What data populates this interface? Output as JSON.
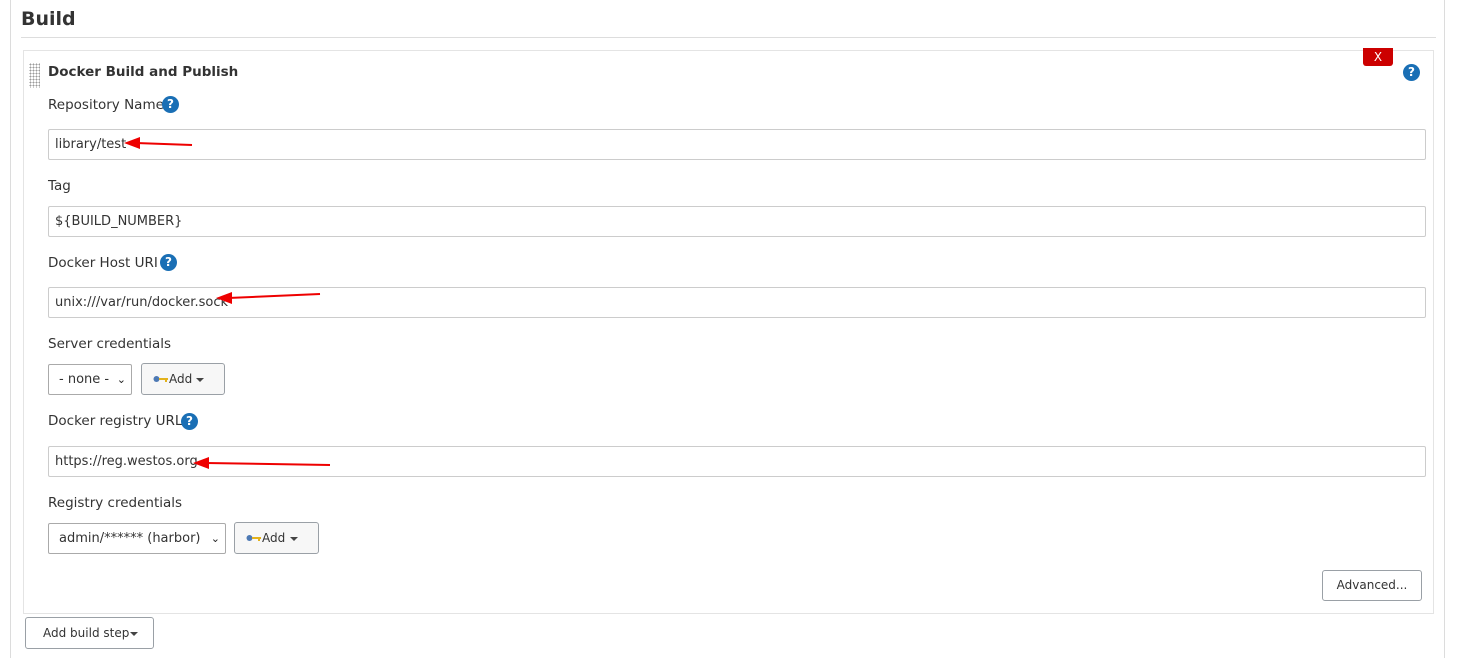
{
  "section": {
    "title": "Build"
  },
  "step": {
    "title": "Docker Build and Publish",
    "delete_label": "X",
    "help_icon": "?"
  },
  "fields": {
    "repository_name": {
      "label": "Repository Name",
      "value": "library/test"
    },
    "tag": {
      "label": "Tag",
      "value": "${BUILD_NUMBER}"
    },
    "docker_host_uri": {
      "label": "Docker Host URI",
      "value": "unix:///var/run/docker.sock"
    },
    "server_credentials": {
      "label": "Server credentials",
      "selected": "- none -",
      "add_label": "Add"
    },
    "docker_registry_url": {
      "label": "Docker registry URL",
      "value": "https://reg.westos.org"
    },
    "registry_credentials": {
      "label": "Registry credentials",
      "selected": "admin/****** (harbor)",
      "add_label": "Add"
    }
  },
  "buttons": {
    "advanced": "Advanced...",
    "add_build_step": "Add build step"
  },
  "colors": {
    "help": "#1a6fb5",
    "delete": "#cc0000",
    "annotation_arrow": "#ee0000"
  }
}
